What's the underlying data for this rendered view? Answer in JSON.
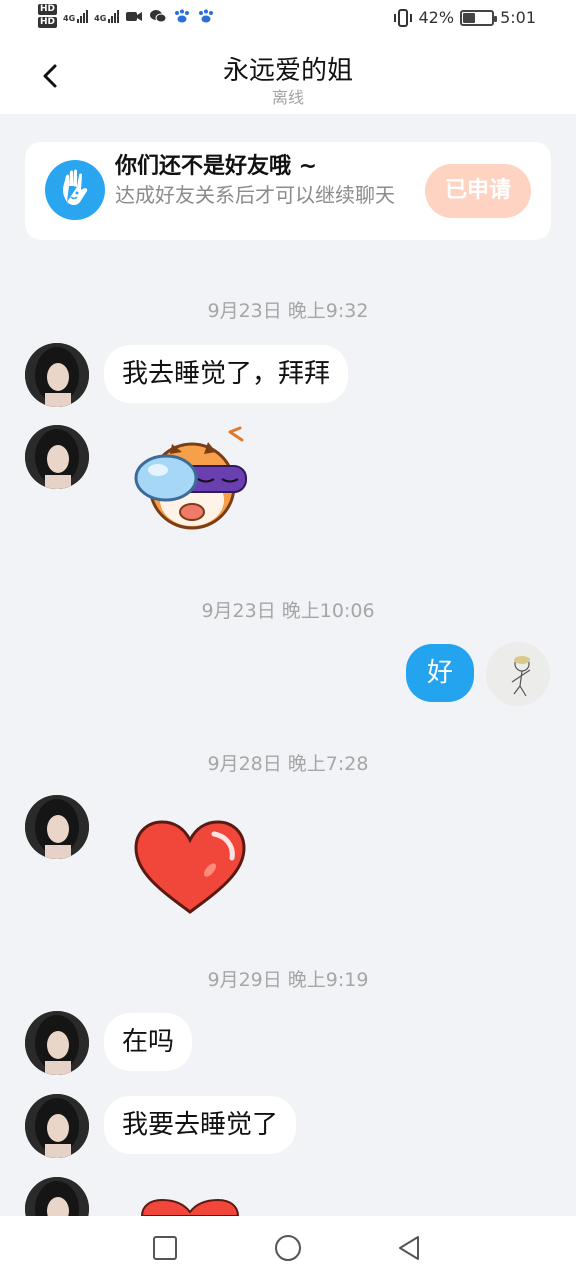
{
  "status_bar": {
    "hd1": "HD",
    "hd2": "HD",
    "net1": "4G",
    "net2": "4G",
    "battery_percent": "42%",
    "battery_level": 0.42,
    "time": "5:01",
    "icons": [
      "signal-icon",
      "video-icon",
      "wechat-icon",
      "paw-icon",
      "vibrate-icon",
      "battery-icon"
    ]
  },
  "header": {
    "title": "永远爱的姐",
    "subtitle": "离线",
    "back_icon": "chevron-left-icon"
  },
  "friend_banner": {
    "title": "你们还不是好友哦 ~",
    "description": "达成好友关系后才可以继续聊天",
    "button_label": "已申请",
    "icon": "wave-hand-icon"
  },
  "messages": {
    "ts1": "9月23日 晚上9:32",
    "m1": "我去睡觉了，拜拜",
    "m2_sticker": "sleeping-tiger-sticker",
    "ts2": "9月23日 晚上10:06",
    "m3": "好",
    "ts3": "9月28日 晚上7:28",
    "m4_sticker": "heart-sticker",
    "ts4": "9月29日 晚上9:19",
    "m5": "在吗",
    "m6": "我要去睡觉了",
    "m7_sticker": "heart-sticker"
  },
  "colors": {
    "accent_blue": "#24a4ef",
    "applied_button": "#ffd3c2",
    "background": "#f2f3f7",
    "heart": "#f0473a"
  },
  "system_nav": {
    "icons": [
      "recent-apps-icon",
      "home-icon",
      "back-icon"
    ]
  }
}
